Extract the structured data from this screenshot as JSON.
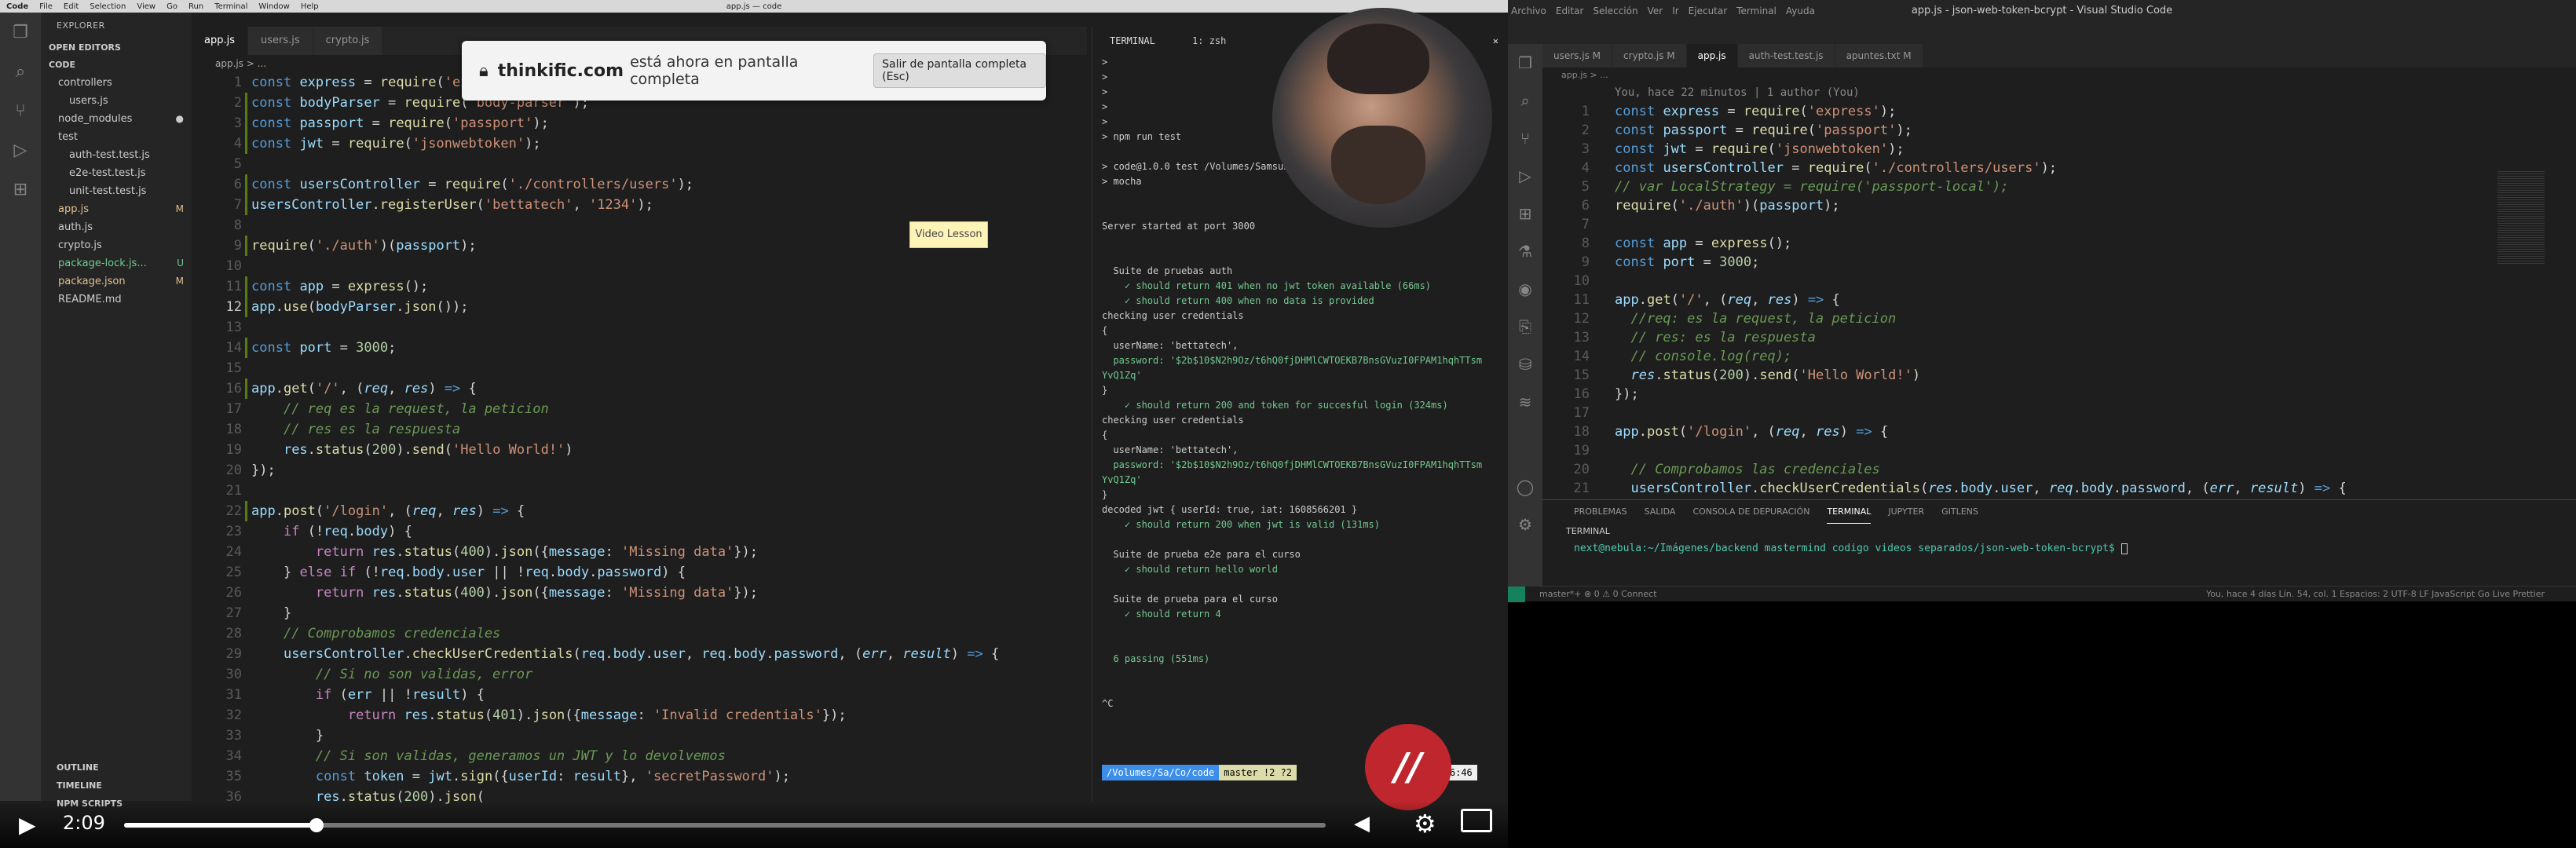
{
  "video": {
    "menubar": {
      "apple": "",
      "items": [
        "Code",
        "File",
        "Edit",
        "Selection",
        "View",
        "Go",
        "Run",
        "Terminal",
        "Window",
        "Help"
      ],
      "center_title": "app.js — code"
    },
    "popup": {
      "site": "thinkific.com",
      "message": "está ahora en pantalla completa",
      "button": "Salir de pantalla completa (Esc)"
    },
    "badge": "Video Lesson",
    "sidebar": {
      "header": "EXPLORER",
      "sections": [
        "OPEN EDITORS",
        "CODE"
      ],
      "items": [
        {
          "label": "controllers",
          "indent": 1,
          "color": "#cccccc",
          "badge": ""
        },
        {
          "label": "users.js",
          "indent": 2,
          "color": "#cccccc",
          "badge": ""
        },
        {
          "label": "node_modules",
          "indent": 1,
          "color": "#cccccc",
          "badge": "●"
        },
        {
          "label": "test",
          "indent": 1,
          "color": "#cccccc",
          "badge": ""
        },
        {
          "label": "auth-test.test.js",
          "indent": 2,
          "color": "#cccccc",
          "badge": ""
        },
        {
          "label": "e2e-test.test.js",
          "indent": 2,
          "color": "#cccccc",
          "badge": ""
        },
        {
          "label": "unit-test.test.js",
          "indent": 2,
          "color": "#cccccc",
          "badge": ""
        },
        {
          "label": "app.js",
          "indent": 1,
          "color": "#e2c08d",
          "badge": "M"
        },
        {
          "label": "auth.js",
          "indent": 1,
          "color": "#cccccc",
          "badge": ""
        },
        {
          "label": "crypto.js",
          "indent": 1,
          "color": "#cccccc",
          "badge": ""
        },
        {
          "label": "package-lock.js...",
          "indent": 1,
          "color": "#73c991",
          "badge": "U"
        },
        {
          "label": "package.json",
          "indent": 1,
          "color": "#e2c08d",
          "badge": "M"
        },
        {
          "label": "README.md",
          "indent": 1,
          "color": "#cccccc",
          "badge": ""
        }
      ],
      "bottom": [
        "OUTLINE",
        "TIMELINE",
        "NPM SCRIPTS"
      ]
    },
    "tabs": [
      "app.js",
      "users.js",
      "crypto.js"
    ],
    "breadcrumb": "app.js > ...",
    "terminal": {
      "header": "TERMINAL",
      "shell": "1: zsh",
      "lines": [
        {
          "t": ">",
          "c": ""
        },
        {
          "t": ">",
          "c": ""
        },
        {
          "t": ">",
          "c": ""
        },
        {
          "t": ">",
          "c": ""
        },
        {
          "t": ">",
          "c": ""
        },
        {
          "t": "> npm run test",
          "c": ""
        },
        {
          "t": "",
          "c": ""
        },
        {
          "t": "> code@1.0.0 test /Volumes/Samsung_l...",
          "c": ""
        },
        {
          "t": "> mocha",
          "c": ""
        },
        {
          "t": "",
          "c": ""
        },
        {
          "t": "",
          "c": ""
        },
        {
          "t": "Server started at port 3000",
          "c": ""
        },
        {
          "t": "",
          "c": ""
        },
        {
          "t": "",
          "c": ""
        },
        {
          "t": "  Suite de pruebas auth",
          "c": ""
        },
        {
          "t": "    ✓ should return 401 when no jwt token available (66ms)",
          "c": "g"
        },
        {
          "t": "    ✓ should return 400 when no data is provided",
          "c": "g"
        },
        {
          "t": "checking user credentials",
          "c": ""
        },
        {
          "t": "{",
          "c": ""
        },
        {
          "t": "  userName: 'bettatech',",
          "c": ""
        },
        {
          "t": "  password: '$2b$10$N2h9Oz/t6hQ0fjDHMlCWTOEKB7BnsGVuzI0FPAM1hqhTTsm",
          "c": "g"
        },
        {
          "t": "YvQ1Zq'",
          "c": "g"
        },
        {
          "t": "}",
          "c": ""
        },
        {
          "t": "    ✓ should return 200 and token for succesful login (324ms)",
          "c": "g"
        },
        {
          "t": "checking user credentials",
          "c": ""
        },
        {
          "t": "{",
          "c": ""
        },
        {
          "t": "  userName: 'bettatech',",
          "c": ""
        },
        {
          "t": "  password: '$2b$10$N2h9Oz/t6hQ0fjDHMlCWTOEKB7BnsGVuzI0FPAM1hqhTTsm",
          "c": "g"
        },
        {
          "t": "YvQ1Zq'",
          "c": "g"
        },
        {
          "t": "}",
          "c": ""
        },
        {
          "t": "decoded jwt { userId: true, iat: 1608566201 }",
          "c": ""
        },
        {
          "t": "    ✓ should return 200 when jwt is valid (131ms)",
          "c": "g"
        },
        {
          "t": "",
          "c": ""
        },
        {
          "t": "  Suite de prueba e2e para el curso",
          "c": ""
        },
        {
          "t": "    ✓ should return hello world",
          "c": "g"
        },
        {
          "t": "",
          "c": ""
        },
        {
          "t": "  Suite de prueba para el curso",
          "c": ""
        },
        {
          "t": "    ✓ should return 4",
          "c": "g"
        },
        {
          "t": "",
          "c": ""
        },
        {
          "t": "",
          "c": ""
        },
        {
          "t": "  6 passing (551ms)",
          "c": "g"
        },
        {
          "t": "",
          "c": ""
        },
        {
          "t": "",
          "c": ""
        },
        {
          "t": "^C",
          "c": ""
        }
      ],
      "prompt_path": "/Volumes/Sa/Co/code",
      "prompt_branch": "master !2 ?2",
      "prompt_time": "16:56:46"
    },
    "player": {
      "time": "2:09",
      "progress": 0.16
    }
  },
  "right": {
    "menu": [
      "Archivo",
      "Editar",
      "Selección",
      "Ver",
      "Ir",
      "Ejecutar",
      "Terminal",
      "Ayuda"
    ],
    "title": "app.js - json-web-token-bcrypt - Visual Studio Code",
    "tabs": [
      {
        "label": "users.js  M",
        "active": false
      },
      {
        "label": "crypto.js  M",
        "active": false
      },
      {
        "label": "app.js",
        "active": true
      },
      {
        "label": "auth-test.test.js",
        "active": false
      },
      {
        "label": "apuntes.txt  M",
        "active": false
      }
    ],
    "breadcrumb": "app.js > ...",
    "blame": "You, hace 22 minutos | 1 author (You)",
    "panel_tabs": [
      "PROBLEMAS",
      "SALIDA",
      "CONSOLA DE DEPURACIÓN",
      "TERMINAL",
      "JUPYTER",
      "GITLENS"
    ],
    "terminal_header": "TERMINAL",
    "prompt": "next@nebula:~/Imágenes/backend mastermind codigo videos separados/json-web-token-bcrypt$ ",
    "status_left": "master*+   ⊗ 0 ⚠ 0   Connect",
    "status_right": "You, hace 4 días   Lín. 54, col. 1   Espacios: 2   UTF-8   LF   JavaScript   Go Live   Prettier"
  }
}
